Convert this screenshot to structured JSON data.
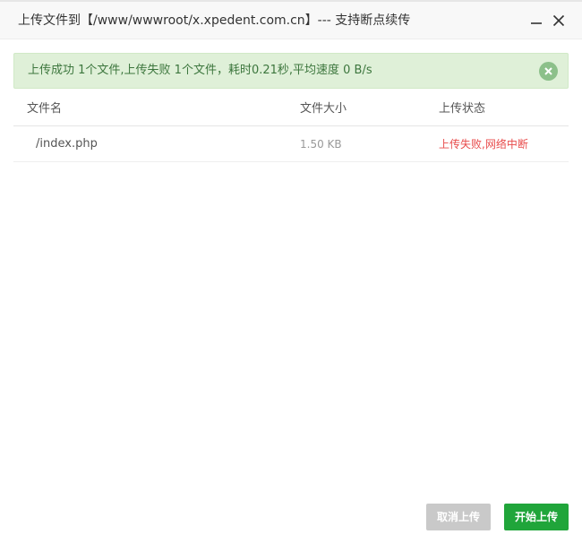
{
  "dialog": {
    "title": "上传文件到【/www/wwwroot/x.xpedent.com.cn】--- 支持断点续传",
    "minimize_icon": "minimize-icon",
    "close_icon": "close-icon"
  },
  "alert": {
    "message": "上传成功 1个文件,上传失败 1个文件，耗时0.21秒,平均速度 0 B/s",
    "close_icon": "close-circle-icon",
    "colors": {
      "background": "#dff0d8",
      "text": "#3c763d"
    }
  },
  "table": {
    "headers": {
      "name": "文件名",
      "size": "文件大小",
      "status": "上传状态"
    },
    "rows": [
      {
        "name": "/index.php",
        "size": "1.50 KB",
        "status": "上传失败,网络中断"
      }
    ]
  },
  "footer": {
    "cancel_label": "取消上传",
    "start_label": "开始上传",
    "colors": {
      "start": "#20a53a",
      "cancel": "#c9c9c9"
    }
  }
}
